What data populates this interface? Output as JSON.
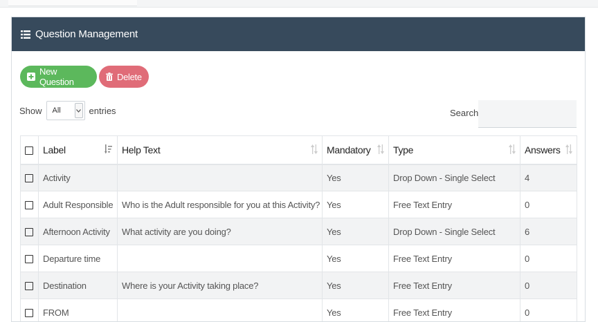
{
  "panel": {
    "title": "Question Management"
  },
  "toolbar": {
    "new_label": "New Question",
    "delete_label": "Delete"
  },
  "length": {
    "show_label": "Show",
    "selected": "All",
    "entries_label": "entries"
  },
  "search": {
    "label": "Search:",
    "value": ""
  },
  "table": {
    "columns": [
      "Label",
      "Help Text",
      "Mandatory",
      "Type",
      "Answers"
    ],
    "rows": [
      {
        "label": "Activity",
        "help": "",
        "mandatory": "Yes",
        "type": "Drop Down - Single Select",
        "answers": "4"
      },
      {
        "label": "Adult Responsible",
        "help": "Who is the Adult responsible for you at this Activity?",
        "mandatory": "Yes",
        "type": "Free Text Entry",
        "answers": "0"
      },
      {
        "label": "Afternoon Activity",
        "help": "What activity are you doing?",
        "mandatory": "Yes",
        "type": "Drop Down - Single Select",
        "answers": "6"
      },
      {
        "label": "Departure time",
        "help": "",
        "mandatory": "Yes",
        "type": "Free Text Entry",
        "answers": "0"
      },
      {
        "label": "Destination",
        "help": "Where is your Activity taking place?",
        "mandatory": "Yes",
        "type": "Free Text Entry",
        "answers": "0"
      },
      {
        "label": "FROM",
        "help": "",
        "mandatory": "Yes",
        "type": "Free Text Entry",
        "answers": "0"
      }
    ]
  },
  "colors": {
    "header_bg": "#374a5c",
    "new_bg": "#5cb85c",
    "delete_bg": "#e06c78"
  },
  "icons": {
    "header": "list-icon",
    "new": "plus-square-icon",
    "delete": "trash-icon",
    "select": "chevron-down-icon",
    "sort": "sort-icon"
  }
}
